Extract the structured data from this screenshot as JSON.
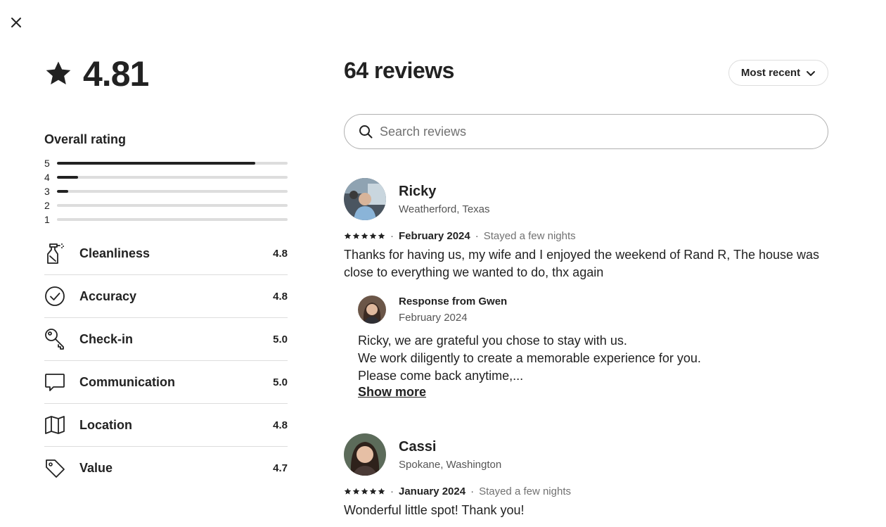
{
  "close": {
    "icon": "close-icon"
  },
  "summary": {
    "score": "4.81",
    "overall_title": "Overall rating",
    "distribution": [
      {
        "label": "5",
        "fraction": 0.86
      },
      {
        "label": "4",
        "fraction": 0.09
      },
      {
        "label": "3",
        "fraction": 0.05
      },
      {
        "label": "2",
        "fraction": 0.0
      },
      {
        "label": "1",
        "fraction": 0.0
      }
    ],
    "categories": [
      {
        "label": "Cleanliness",
        "value": "4.8",
        "icon": "spray-bottle-icon"
      },
      {
        "label": "Accuracy",
        "value": "4.8",
        "icon": "check-circle-icon"
      },
      {
        "label": "Check-in",
        "value": "5.0",
        "icon": "key-icon"
      },
      {
        "label": "Communication",
        "value": "5.0",
        "icon": "chat-bubble-icon"
      },
      {
        "label": "Location",
        "value": "4.8",
        "icon": "map-icon"
      },
      {
        "label": "Value",
        "value": "4.7",
        "icon": "tag-icon"
      }
    ]
  },
  "reviews": {
    "title": "64 reviews",
    "sort_label": "Most recent",
    "search_placeholder": "Search reviews",
    "items": [
      {
        "name": "Ricky",
        "location": "Weatherford, Texas",
        "date": "February 2024",
        "stay": "Stayed a few nights",
        "rating": 5,
        "text": "Thanks for having us, my wife and I enjoyed the weekend of Rand R, The house was close to everything we wanted to do, thx again",
        "response": {
          "name": "Response from Gwen",
          "date": "February 2024",
          "lines": [
            "Ricky, we are grateful you chose to stay with us.",
            "We work diligently to create a memorable experience for you.",
            "Please come back anytime,..."
          ],
          "show_more": "Show more"
        }
      },
      {
        "name": "Cassi",
        "location": "Spokane, Washington",
        "date": "January 2024",
        "stay": "Stayed a few nights",
        "rating": 5,
        "text": "Wonderful little spot! Thank you!"
      }
    ]
  }
}
